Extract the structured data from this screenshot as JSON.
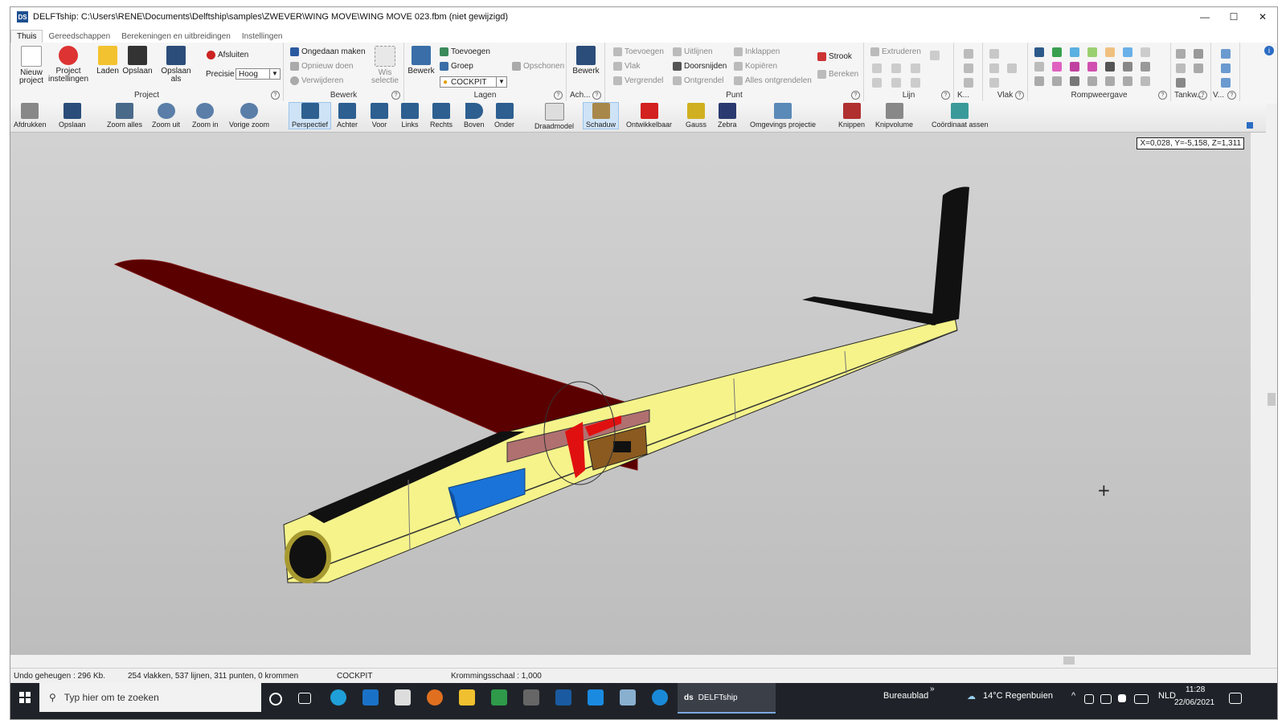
{
  "window": {
    "title": "DELFTship: C:\\Users\\RENE\\Documents\\Delftship\\samples\\ZWEVER\\WING MOVE\\WING MOVE 023.fbm (niet gewijzigd)",
    "app_icon": "DS",
    "minimize": "—",
    "maximize": "☐",
    "close": "✕"
  },
  "tabs": [
    "Thuis",
    "Gereedschappen",
    "Berekeningen en uitbreidingen",
    "Instellingen"
  ],
  "ribbon": {
    "project": {
      "label": "Project",
      "new": "Nieuw project",
      "settings": "Project instellingen",
      "load": "Laden",
      "save": "Opslaan",
      "save_as": "Opslaan als",
      "close": "Afsluiten",
      "precision_label": "Precisie",
      "precision_value": "Hoog"
    },
    "bewerk": {
      "label": "Bewerk",
      "undo": "Ongedaan maken",
      "redo": "Opnieuw doen",
      "delete": "Verwijderen",
      "clear_sel": "Wis selectie"
    },
    "lagen": {
      "label": "Lagen",
      "edit": "Bewerk",
      "add": "Toevoegen",
      "group": "Groep",
      "layer": "COCKPIT",
      "clean": "Opschonen"
    },
    "ach": {
      "label": "Ach...",
      "edit": "Bewerk"
    },
    "punt": {
      "label": "Punt",
      "add": "Toevoegen",
      "face": "Vlak",
      "lock": "Vergrendel",
      "align": "Uitlijnen",
      "intersect": "Doorsnijden",
      "unlock": "Ontgrendel",
      "collapse": "Inklappen",
      "copy": "Kopiëren",
      "unlock_all": "Alles ontgrendelen",
      "strip": "Strook",
      "calc": "Bereken"
    },
    "lijn": {
      "label": "Lijn",
      "extrude": "Extruderen"
    },
    "k": {
      "label": "K..."
    },
    "vlak": {
      "label": "Vlak"
    },
    "romp": {
      "label": "Rompweergave"
    },
    "tank": {
      "label": "Tankw..."
    },
    "v": {
      "label": "V..."
    },
    "help": "?"
  },
  "toolbar": [
    "Afdrukken",
    "Opslaan",
    "Zoom alles",
    "Zoom uit",
    "Zoom in",
    "Vorige zoom",
    "Perspectief",
    "Achter",
    "Voor",
    "Links",
    "Rechts",
    "Boven",
    "Onder",
    "Draadmodel",
    "Schaduw",
    "Ontwikkelbaar",
    "Gauss",
    "Zebra",
    "Omgevings projectie",
    "Knippen",
    "Knipvolume",
    "Coördinaat assen"
  ],
  "viewport": {
    "coords": "X=0,028, Y=-5,158, Z=1,311",
    "cursor": "+"
  },
  "status": {
    "undo": "Undo geheugen : 296 Kb.",
    "counts": "254 vlakken, 537 lijnen, 311 punten, 0 krommen",
    "layer": "COCKPIT",
    "curvature": "Krommingsschaal : 1,000"
  },
  "taskbar": {
    "search_placeholder": "Typ hier om te zoeken",
    "app": "DELFTship",
    "desktop": "Bureaublad",
    "chevron": "»",
    "weather": "14°C  Regenbuien",
    "lang": "NLD",
    "time": "11:28",
    "date": "22/06/2021"
  },
  "colors": {
    "wing": "#5a0000",
    "fuselage": "#f5f38a",
    "battery": "#1a73d8",
    "rudder": "#111111"
  }
}
